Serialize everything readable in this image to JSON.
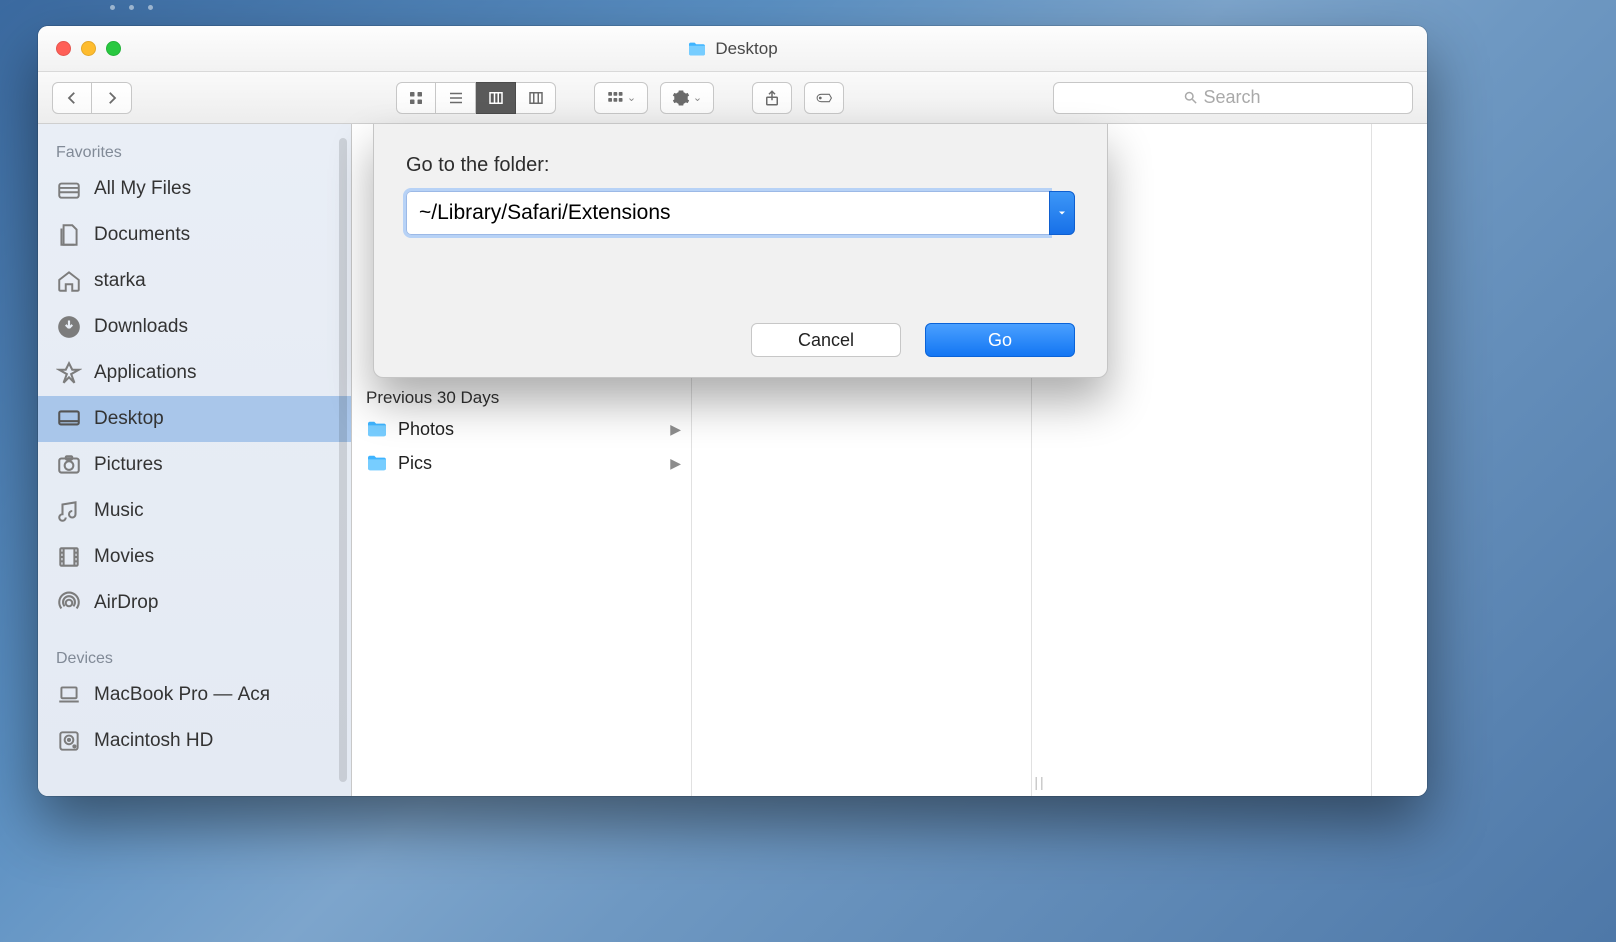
{
  "window": {
    "title": "Desktop"
  },
  "toolbar": {
    "search_placeholder": "Search"
  },
  "sidebar": {
    "sections": [
      {
        "title": "Favorites",
        "items": [
          {
            "label": "All My Files",
            "icon": "all-files-icon"
          },
          {
            "label": "Documents",
            "icon": "documents-icon"
          },
          {
            "label": "starka",
            "icon": "home-icon"
          },
          {
            "label": "Downloads",
            "icon": "downloads-icon"
          },
          {
            "label": "Applications",
            "icon": "applications-icon"
          },
          {
            "label": "Desktop",
            "icon": "desktop-icon",
            "selected": true
          },
          {
            "label": "Pictures",
            "icon": "pictures-icon"
          },
          {
            "label": "Music",
            "icon": "music-icon"
          },
          {
            "label": "Movies",
            "icon": "movies-icon"
          },
          {
            "label": "AirDrop",
            "icon": "airdrop-icon"
          }
        ]
      },
      {
        "title": "Devices",
        "items": [
          {
            "label": "MacBook Pro — Ася",
            "icon": "laptop-icon"
          },
          {
            "label": "Macintosh HD",
            "icon": "hdd-icon"
          }
        ]
      }
    ]
  },
  "browser": {
    "column0": {
      "header": "Previous 30 Days",
      "items": [
        {
          "label": "Photos"
        },
        {
          "label": "Pics"
        }
      ]
    }
  },
  "dialog": {
    "title": "Go to the folder:",
    "path": "~/Library/Safari/Extensions",
    "cancel_label": "Cancel",
    "go_label": "Go"
  }
}
